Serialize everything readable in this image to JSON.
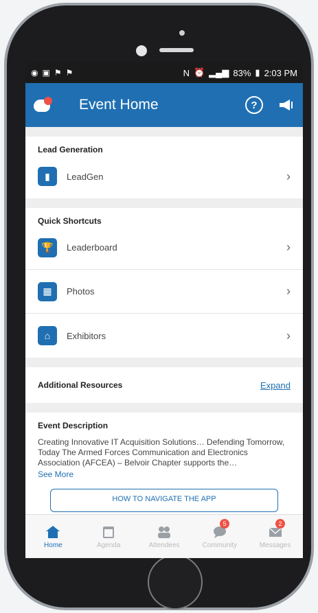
{
  "statusbar": {
    "left_icons": [
      "messenger-icon",
      "gallery-icon",
      "flag-icon",
      "flag-icon"
    ],
    "right_text": "83%",
    "time": "2:03 PM"
  },
  "appbar": {
    "title": "Event Home",
    "help_icon": "?",
    "announcement_icon": "megaphone-icon"
  },
  "lead_section": {
    "title": "Lead Generation",
    "items": [
      {
        "label": "LeadGen",
        "icon": "leadgen-icon"
      }
    ]
  },
  "shortcuts_section": {
    "title": "Quick Shortcuts",
    "items": [
      {
        "label": "Leaderboard",
        "icon": "trophy-icon"
      },
      {
        "label": "Photos",
        "icon": "photo-icon"
      },
      {
        "label": "Exhibitors",
        "icon": "exhibitor-icon"
      }
    ]
  },
  "resources": {
    "title": "Additional Resources",
    "expand_label": "Expand"
  },
  "description": {
    "title": "Event Description",
    "text": "Creating Innovative IT Acquisition Solutions… Defending Tomorrow, Today The Armed Forces Communication and Electronics Association (AFCEA) – Belvoir Chapter supports the…",
    "see_more": "See More",
    "howto_button": "HOW TO NAVIGATE THE APP"
  },
  "tabs": [
    {
      "label": "Home",
      "active": true
    },
    {
      "label": "Agenda",
      "active": false
    },
    {
      "label": "Attendees",
      "active": false
    },
    {
      "label": "Community",
      "active": false,
      "badge": "5"
    },
    {
      "label": "Messages",
      "active": false,
      "badge": "2"
    }
  ],
  "colors": {
    "brand_blue": "#1f6fb2",
    "badge_red": "#ef5245"
  }
}
